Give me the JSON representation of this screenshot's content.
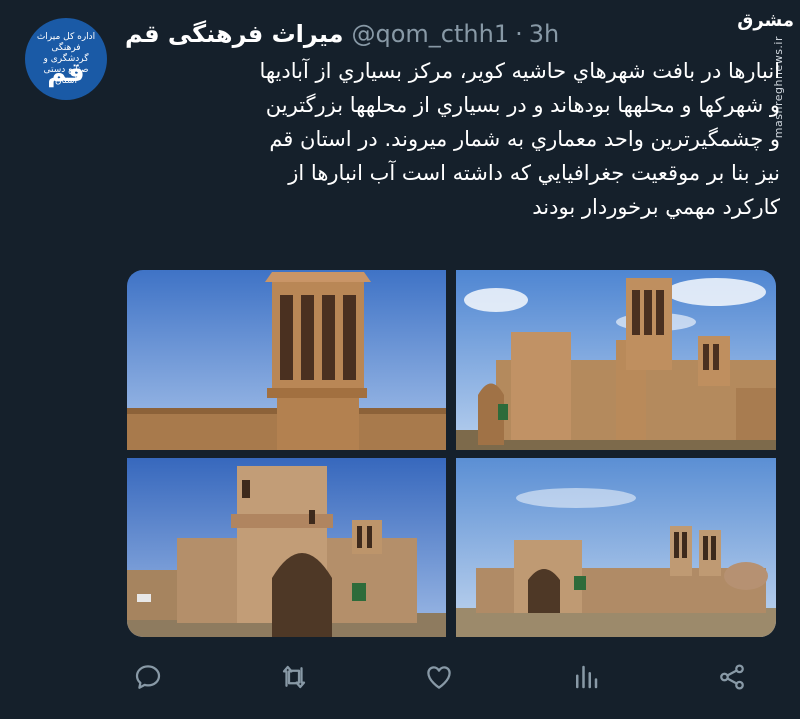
{
  "tweet": {
    "avatar": {
      "small_text": "اداره کل میراث فرهنگی گردشگری و صنایع دستی استان",
      "big_text": "قم"
    },
    "display_name": "میراث فرهنگی قم",
    "handle": "@qom_cthh1",
    "separator": "·",
    "time": "3h",
    "text_lines": [
      "انبارها در بافت شهرهاي حاشيه كوير، مركز بسياري از آباديها",
      "و شهركها و محلهها بودهاند و در بسياري از محلهها بزرگترين",
      "و چشمگيرترين واحد معماري به شمار ميروند. در استان قم",
      "نيز بنا بر موقعيت جغرافيايي كه داشته است آب انبارها از",
      "كاركرد مهمي برخوردار بودند"
    ],
    "media": [
      {
        "icon": "windcatcher-photo"
      },
      {
        "icon": "water-reservoir-photo"
      },
      {
        "icon": "reservoir-entrance-photo"
      },
      {
        "icon": "reservoir-wide-photo"
      }
    ],
    "actions": [
      {
        "icon": "reply-icon"
      },
      {
        "icon": "retweet-icon"
      },
      {
        "icon": "like-icon"
      },
      {
        "icon": "analytics-icon"
      },
      {
        "icon": "share-icon"
      }
    ]
  },
  "watermark": {
    "logo": "مشرق",
    "url": "mashreghnews.ir"
  },
  "colors": {
    "background": "#15202b",
    "text": "#ffffff",
    "secondary": "#8899a6",
    "avatar": "#1a5aa6"
  }
}
